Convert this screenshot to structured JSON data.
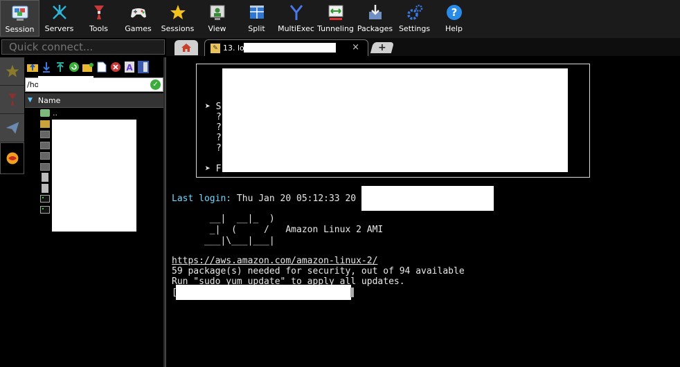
{
  "toolbar": {
    "items": [
      {
        "label": "Session",
        "icon": "session-icon",
        "active": true
      },
      {
        "label": "Servers",
        "icon": "servers-icon"
      },
      {
        "label": "Tools",
        "icon": "tools-icon"
      },
      {
        "label": "Games",
        "icon": "games-icon"
      },
      {
        "label": "Sessions",
        "icon": "sessions-star-icon"
      },
      {
        "label": "View",
        "icon": "view-icon"
      },
      {
        "label": "Split",
        "icon": "split-icon"
      },
      {
        "label": "MultiExec",
        "icon": "multiexec-icon"
      },
      {
        "label": "Tunneling",
        "icon": "tunneling-icon"
      },
      {
        "label": "Packages",
        "icon": "packages-icon"
      },
      {
        "label": "Settings",
        "icon": "settings-icon"
      },
      {
        "label": "Help",
        "icon": "help-icon"
      }
    ]
  },
  "quick_connect": {
    "placeholder": "Quick connect..."
  },
  "tabs": {
    "session_tab_label": "13. loc",
    "close_glyph": "×",
    "new_tab_glyph": "+"
  },
  "file_browser": {
    "path": "/ho",
    "column_header": "Name",
    "parent_label": ".."
  },
  "terminal": {
    "motd": {
      "bullet1": "➤ S",
      "q1": "?",
      "q2": "?",
      "q3": "?",
      "q4": "?",
      "bullet2": "➤ F"
    },
    "last_login_label": "Last login:",
    "last_login_value": " Thu Jan 20 05:12:33 20",
    "banner_line1": "       __|  __|_  )",
    "banner_line2": "       _|  (     /   Amazon Linux 2 AMI",
    "banner_line3": "      ___|\\___|___|",
    "url": "https://aws.amazon.com/amazon-linux-2/",
    "security_line": "59 package(s) needed for security, out of 94 available",
    "update_line": "Run \"sudo yum update\" to apply all updates.",
    "prompt_start": "["
  },
  "colors": {
    "accent_cyan": "#6cd9ff",
    "toolbar_bg": "#1b1b1b"
  }
}
